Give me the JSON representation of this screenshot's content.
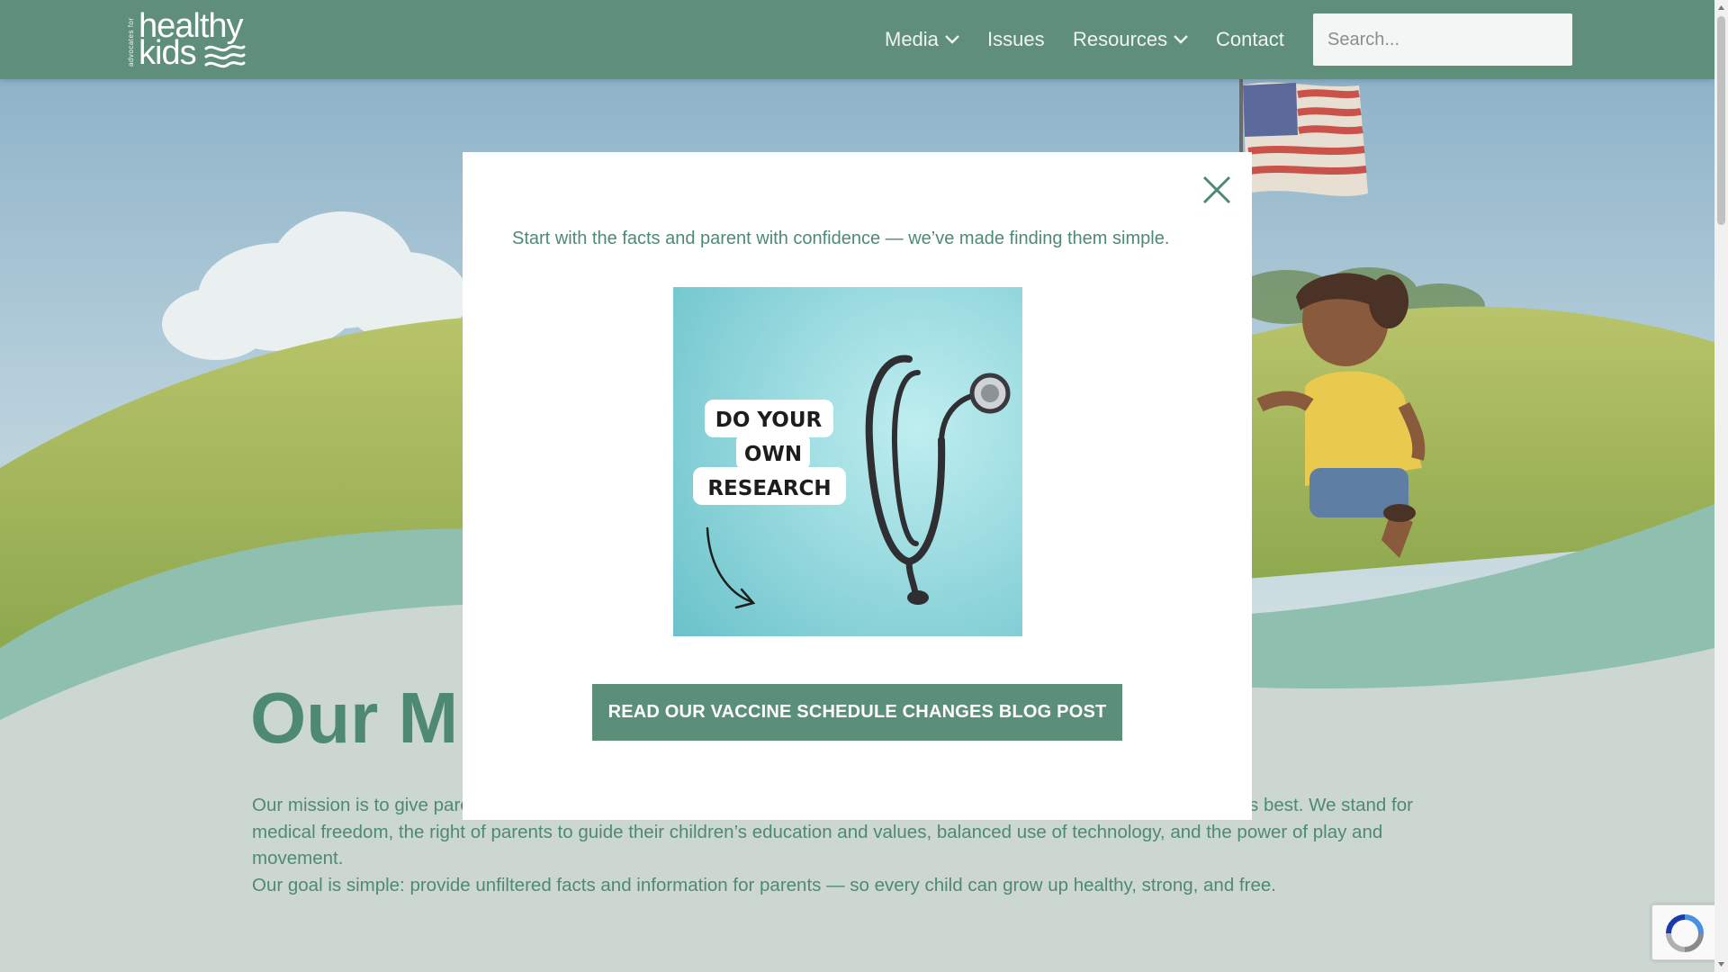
{
  "header": {
    "logo": {
      "tagline": "advocates for",
      "line1": "healthy",
      "line2": "kids"
    },
    "nav": {
      "media": "Media",
      "issues": "Issues",
      "resources": "Resources",
      "contact": "Contact"
    },
    "search": {
      "placeholder": "Search..."
    }
  },
  "main": {
    "mission_title": "Our Mission",
    "mission_text_visible_left": "Our mission is to give pare",
    "mission_text_visible_right": "s best. We stand for",
    "mission_text_line2": "medical freedom, the right of parents to guide their children’s education and values, balanced use of technology, and the power of play and movement.",
    "mission_text_line3": "Our goal is simple: provide unfiltered facts and information for parents — so every child can grow up healthy, strong, and free."
  },
  "modal": {
    "message": "Start with the facts and parent with confidence — we’ve made finding them simple.",
    "image_text": [
      "DO YOUR",
      "OWN",
      "RESEARCH"
    ],
    "cta_label": "READ OUR VACCINE SCHEDULE CHANGES BLOG POST",
    "close_icon": "close-icon"
  },
  "colors": {
    "header_bg": "#5f8f7b",
    "accent_green": "#4e8a73",
    "button_bg": "#5c8f79",
    "teal_wave": "#8fbfae",
    "image_bg": "#7ecfd6"
  },
  "icons": [
    "chevron-down-icon",
    "close-icon",
    "stethoscope-icon",
    "arrow-icon",
    "recaptcha-icon",
    "flag-icon"
  ]
}
